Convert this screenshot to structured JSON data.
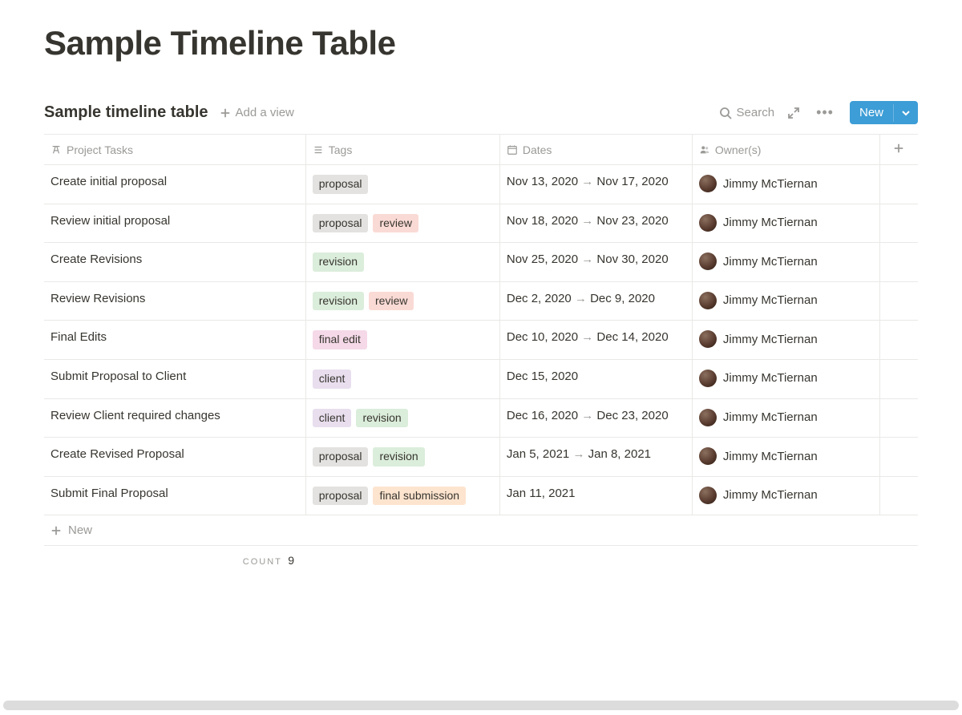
{
  "page": {
    "title": "Sample Timeline Table"
  },
  "table": {
    "title": "Sample timeline table",
    "add_view_label": "Add a view",
    "search_label": "Search",
    "new_button_label": "New",
    "new_row_label": "New",
    "count_label": "COUNT",
    "count_value": "9",
    "columns": {
      "tasks": "Project Tasks",
      "tags": "Tags",
      "dates": "Dates",
      "owners": "Owner(s)"
    },
    "tag_styles": {
      "proposal": "tag-proposal",
      "review": "tag-review",
      "revision": "tag-revision",
      "final edit": "tag-finaledit",
      "client": "tag-client",
      "final submission": "tag-finalsubmission"
    },
    "rows": [
      {
        "task": "Create initial proposal",
        "tags": [
          "proposal"
        ],
        "date_start": "Nov 13, 2020",
        "date_end": "Nov 17, 2020",
        "owner": "Jimmy McTiernan"
      },
      {
        "task": "Review initial proposal",
        "tags": [
          "proposal",
          "review"
        ],
        "date_start": "Nov 18, 2020",
        "date_end": "Nov 23, 2020",
        "owner": "Jimmy McTiernan"
      },
      {
        "task": "Create Revisions",
        "tags": [
          "revision"
        ],
        "date_start": "Nov 25, 2020",
        "date_end": "Nov 30, 2020",
        "owner": "Jimmy McTiernan"
      },
      {
        "task": "Review Revisions",
        "tags": [
          "revision",
          "review"
        ],
        "date_start": "Dec 2, 2020",
        "date_end": "Dec 9, 2020",
        "owner": "Jimmy McTiernan"
      },
      {
        "task": "Final Edits",
        "tags": [
          "final edit"
        ],
        "date_start": "Dec 10, 2020",
        "date_end": "Dec 14, 2020",
        "owner": "Jimmy McTiernan"
      },
      {
        "task": "Submit Proposal to Client",
        "tags": [
          "client"
        ],
        "date_start": "Dec 15, 2020",
        "date_end": "",
        "owner": "Jimmy McTiernan"
      },
      {
        "task": "Review Client required changes",
        "tags": [
          "client",
          "revision"
        ],
        "date_start": "Dec 16, 2020",
        "date_end": "Dec 23, 2020",
        "owner": "Jimmy McTiernan"
      },
      {
        "task": "Create Revised Proposal",
        "tags": [
          "proposal",
          "revision"
        ],
        "date_start": "Jan 5, 2021",
        "date_end": "Jan 8, 2021",
        "owner": "Jimmy McTiernan"
      },
      {
        "task": "Submit Final Proposal",
        "tags": [
          "proposal",
          "final submission"
        ],
        "date_start": "Jan 11, 2021",
        "date_end": "",
        "owner": "Jimmy McTiernan"
      }
    ]
  }
}
